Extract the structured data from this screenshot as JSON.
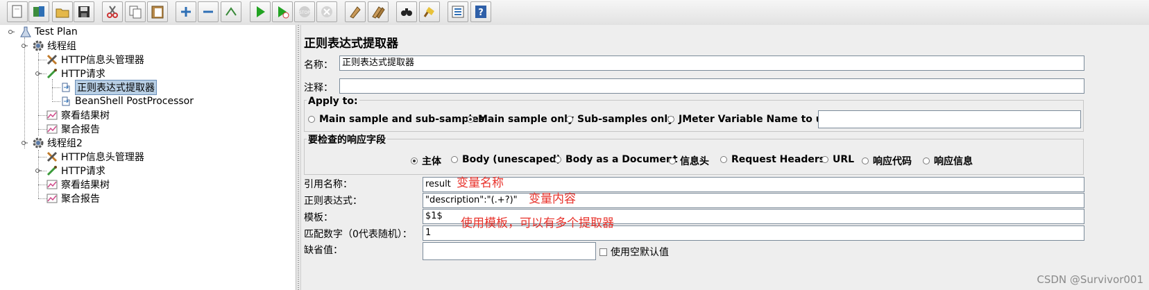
{
  "toolbar": {
    "buttons": [
      {
        "name": "new-icon"
      },
      {
        "name": "templates-icon"
      },
      {
        "name": "open-icon"
      },
      {
        "name": "save-icon"
      },
      {
        "name": "cut-icon"
      },
      {
        "name": "copy-icon"
      },
      {
        "name": "paste-icon"
      },
      {
        "name": "expand-icon"
      },
      {
        "name": "collapse-icon"
      },
      {
        "name": "toggle-icon"
      },
      {
        "name": "start-icon"
      },
      {
        "name": "start-no-pause-icon"
      },
      {
        "name": "stop-icon"
      },
      {
        "name": "shutdown-icon"
      },
      {
        "name": "clear-icon"
      },
      {
        "name": "clear-all-icon"
      },
      {
        "name": "search-icon"
      },
      {
        "name": "reset-search-icon"
      },
      {
        "name": "function-helper-icon"
      },
      {
        "name": "help-icon"
      }
    ]
  },
  "tree": {
    "nodes": [
      {
        "label": "Test Plan",
        "icon": "test-plan-icon"
      },
      {
        "label": "线程组",
        "icon": "gear-icon"
      },
      {
        "label": "HTTP信息头管理器",
        "icon": "tools-icon"
      },
      {
        "label": "HTTP请求",
        "icon": "pipette-icon"
      },
      {
        "label": "正则表达式提取器",
        "icon": "extractor-icon"
      },
      {
        "label": "BeanShell PostProcessor",
        "icon": "extractor-icon"
      },
      {
        "label": "察看结果树",
        "icon": "graph-icon"
      },
      {
        "label": "聚合报告",
        "icon": "graph-icon"
      },
      {
        "label": "线程组2",
        "icon": "gear-icon"
      },
      {
        "label": "HTTP信息头管理器",
        "icon": "tools-icon"
      },
      {
        "label": "HTTP请求",
        "icon": "pipette-icon"
      },
      {
        "label": "察看结果树",
        "icon": "graph-icon"
      },
      {
        "label": "聚合报告",
        "icon": "graph-icon"
      }
    ]
  },
  "panel": {
    "title": "正则表达式提取器",
    "name_label": "名称：",
    "name_value": "正则表达式提取器",
    "comment_label": "注释：",
    "comment_value": "",
    "apply_to": {
      "title": "Apply to:",
      "options": [
        "Main sample and sub-samples",
        "Main sample only",
        "Sub-samples only",
        "JMeter Variable Name to use"
      ],
      "selected": "Main sample only",
      "variable_value": ""
    },
    "field_to_check": {
      "title": "要检查的响应字段",
      "options": [
        "主体",
        "Body (unescaped)",
        "Body as a Document",
        "信息头",
        "Request Headers",
        "URL",
        "响应代码",
        "响应信息"
      ],
      "selected": "主体"
    },
    "ref_name_label": "引用名称：",
    "ref_name_value": "result",
    "regex_label": "正则表达式：",
    "regex_value": "\"description\":\"(.+?)\"",
    "template_label": "模板：",
    "template_value": "$1$",
    "match_no_label": "匹配数字（0代表随机）：",
    "match_no_value": "1",
    "default_label": "缺省值：",
    "default_value": "",
    "empty_default_label": "使用空默认值"
  },
  "annotations": {
    "var_name": "变量名称",
    "var_content": "变量内容",
    "template_note": "使用模板，可以有多个提取器"
  },
  "watermark": "CSDN @Survivor001",
  "colors": {
    "annotation": "#e8322b",
    "selection": "#b8cfe5"
  }
}
